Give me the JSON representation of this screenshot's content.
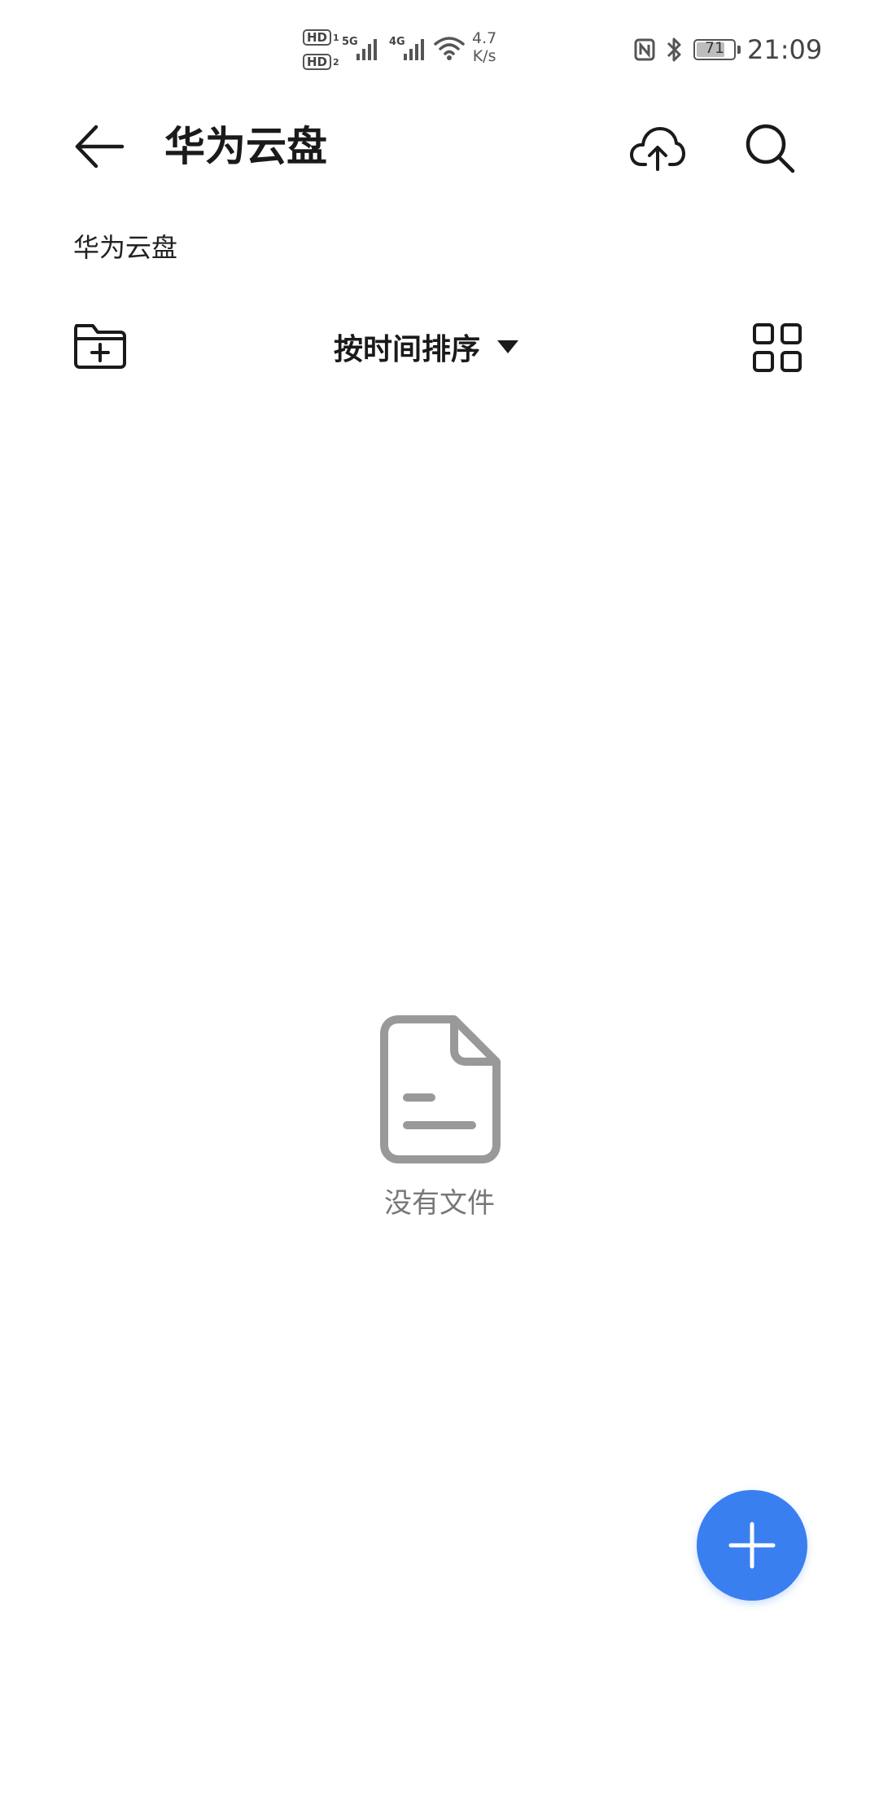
{
  "status_bar": {
    "hd1": "HD",
    "hd1_sim": "1",
    "hd2": "HD",
    "hd2_sim": "2",
    "net1": "5G",
    "net2": "4G",
    "speed_value": "4.7",
    "speed_unit": "K/s",
    "battery_level": "71",
    "time": "21:09"
  },
  "header": {
    "title": "华为云盘",
    "back_icon": "arrow-left-icon",
    "upload_icon": "cloud-upload-icon",
    "search_icon": "search-icon"
  },
  "breadcrumb": {
    "path": "华为云盘"
  },
  "toolbar": {
    "new_folder_icon": "folder-add-icon",
    "sort_label": "按时间排序",
    "sort_icon": "triangle-down-icon",
    "view_icon": "grid-view-icon"
  },
  "empty_state": {
    "icon": "document-icon",
    "message": "没有文件"
  },
  "fab": {
    "icon": "plus-icon",
    "color": "#3a7ff0"
  },
  "colors": {
    "text_primary": "#1a1a1a",
    "text_secondary": "#777777",
    "icon_gray": "#999999",
    "accent": "#3a7ff0"
  }
}
